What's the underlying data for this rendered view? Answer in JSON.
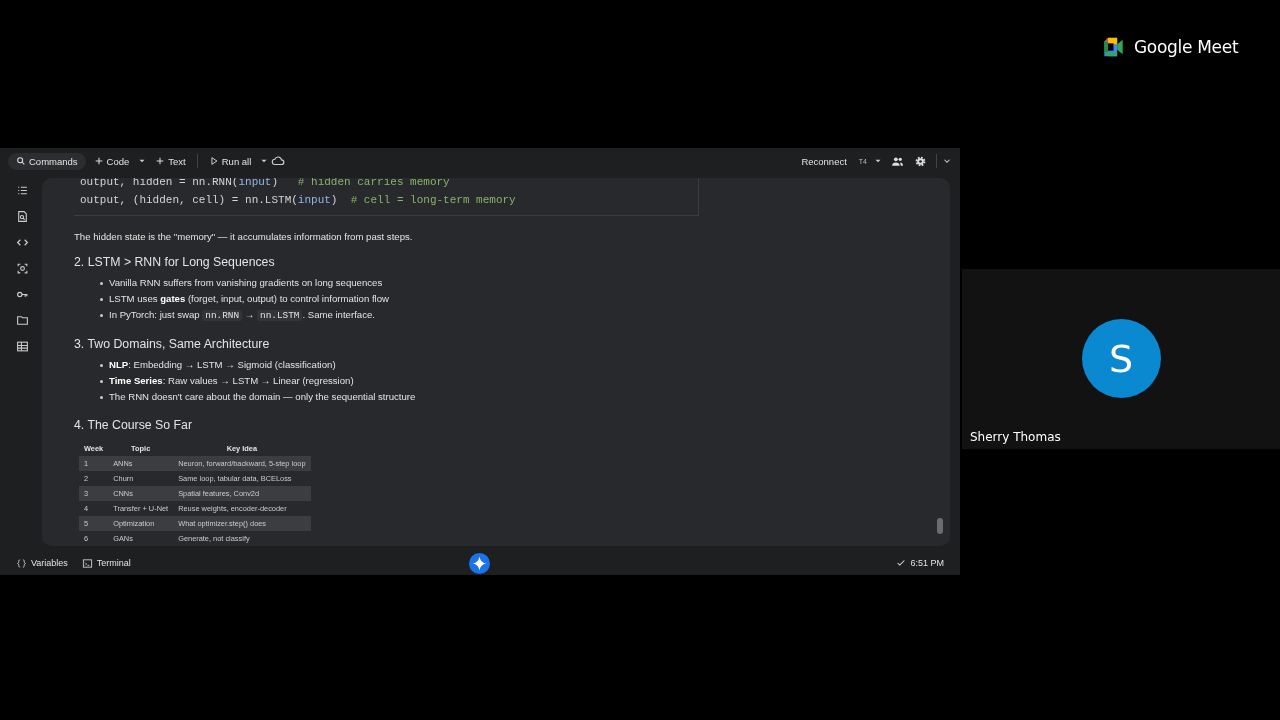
{
  "notebook": {
    "toolbar": {
      "left": [
        {
          "kind": "search",
          "label": "Commands"
        },
        {
          "kind": "add",
          "label": "Code",
          "dropdown": true
        },
        {
          "kind": "add",
          "label": "Text",
          "dropdown": false
        },
        {
          "kind": "run",
          "label": "Run all",
          "dropdown": true
        },
        {
          "kind": "cloud"
        }
      ],
      "connect": "Reconnect",
      "runtime": "T4"
    },
    "cells": [
      {
        "kind": "code",
        "lines": [
          [
            {
              "kind": "plain",
              "text": "output, hidden = nn.RNN("
            },
            {
              "kind": "var",
              "text": "input"
            },
            {
              "kind": "plain",
              "text": ")   "
            },
            {
              "kind": "comment",
              "text": "# hidden carries memory"
            }
          ],
          [
            {
              "kind": "plain",
              "text": "output, (hidden, cell) = nn.LSTM("
            },
            {
              "kind": "var",
              "text": "input"
            },
            {
              "kind": "plain",
              "text": ")  "
            },
            {
              "kind": "comment",
              "text": "# cell = long-term memory"
            }
          ]
        ]
      },
      {
        "kind": "paragraph",
        "text": "The hidden state is the \"memory\" — it accumulates information from past steps."
      },
      {
        "kind": "heading",
        "text": "2. LSTM > RNN for Long Sequences"
      },
      {
        "kind": "bullets",
        "items": [
          [
            {
              "kind": "text",
              "text": "Vanilla RNN suffers from vanishing gradients on long sequences"
            }
          ],
          [
            {
              "kind": "text",
              "text": "LSTM uses **gates** (forget, input, output) to control information flow"
            }
          ],
          [
            {
              "kind": "text",
              "text": "In PyTorch: just swap "
            },
            {
              "kind": "code",
              "text": "nn.RNN"
            },
            {
              "kind": "text",
              "text": " → "
            },
            {
              "kind": "code",
              "text": "nn.LSTM"
            },
            {
              "kind": "text",
              "text": ". Same interface."
            }
          ]
        ]
      },
      {
        "kind": "heading",
        "text": "3. Two Domains, Same Architecture"
      },
      {
        "kind": "bullets",
        "items": [
          [
            {
              "kind": "text",
              "text": "**NLP**: Embedding → LSTM → Sigmoid (classification)"
            }
          ],
          [
            {
              "kind": "text",
              "text": "**Time Series**: Raw values → LSTM → Linear (regression)"
            }
          ],
          [
            {
              "kind": "text",
              "text": "The RNN doesn't care about the domain — only the sequential structure"
            }
          ]
        ]
      },
      {
        "kind": "heading",
        "text": "4. The Course So Far"
      },
      {
        "kind": "table",
        "columns": [
          "Week",
          "Topic",
          "Key Idea"
        ],
        "rows": [
          [
            "1",
            "ANNs",
            "Neuron, forward/backward, 5-step loop"
          ],
          [
            "2",
            "Churn",
            "Same loop, tabular data, BCELoss"
          ],
          [
            "3",
            "CNNs",
            "Spatial features, Conv2d"
          ],
          [
            "4",
            "Transfer + U-Net",
            "Reuse weights, encoder-decoder"
          ],
          [
            "5",
            "Optimization",
            "What optimizer.step() does"
          ],
          [
            "6",
            "GANs",
            "Generate, not classify"
          ]
        ]
      }
    ],
    "status": {
      "left": [
        {
          "kind": "variables",
          "label": "Variables"
        },
        {
          "kind": "terminal",
          "label": "Terminal"
        }
      ],
      "saved": true,
      "time": "6:51 PM"
    }
  },
  "meet": {
    "brand": "Google Meet",
    "participant": {
      "initial": "S",
      "name": "Sherry Thomas"
    }
  }
}
